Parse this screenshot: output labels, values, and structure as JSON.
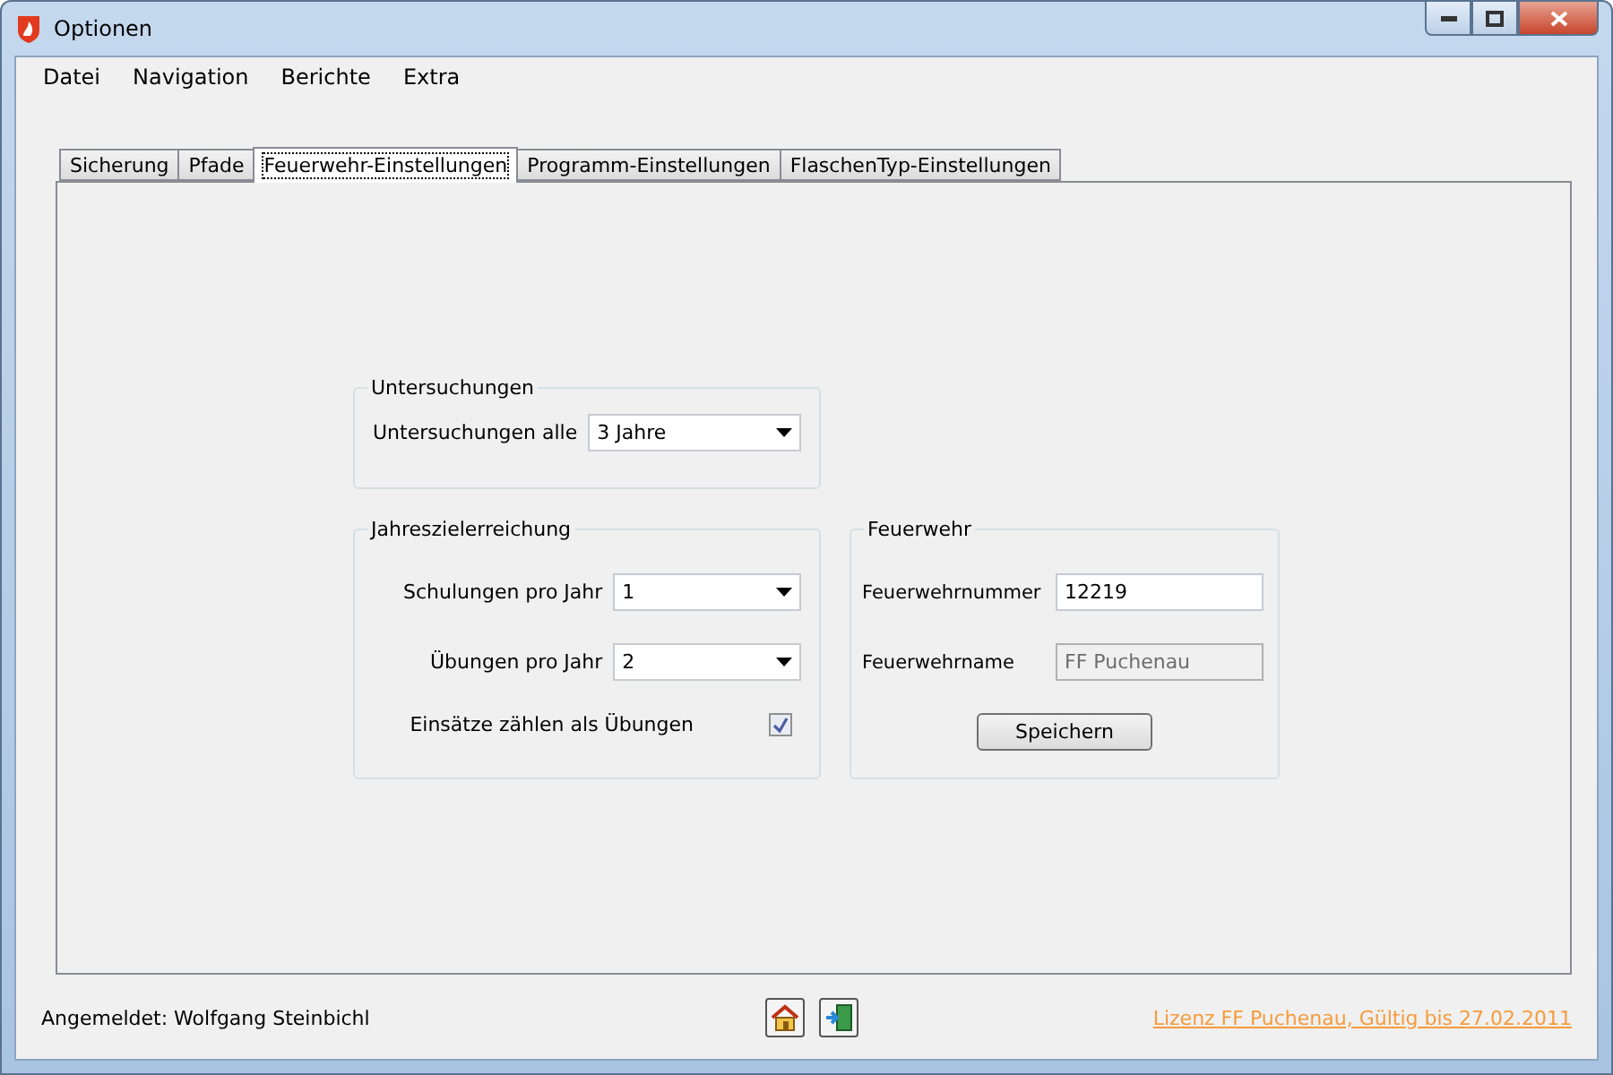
{
  "window": {
    "title": "Optionen"
  },
  "menu": [
    "Datei",
    "Navigation",
    "Berichte",
    "Extra"
  ],
  "tabs": [
    {
      "label": "Sicherung",
      "selected": false
    },
    {
      "label": "Pfade",
      "selected": false
    },
    {
      "label": "Feuerwehr-Einstellungen",
      "selected": true
    },
    {
      "label": "Programm-Einstellungen",
      "selected": false
    },
    {
      "label": "FlaschenTyp-Einstellungen",
      "selected": false
    }
  ],
  "untersuchungen": {
    "title": "Untersuchungen",
    "label": "Untersuchungen alle",
    "value": "3 Jahre"
  },
  "jahreszielerreichung": {
    "title": "Jahreszielerreichung",
    "fields": [
      {
        "label": "Schulungen pro Jahr",
        "value": "1"
      },
      {
        "label": "Übungen pro Jahr",
        "value": "2"
      }
    ],
    "checkbox": {
      "label": "Einsätze zählen als Übungen",
      "checked": true
    }
  },
  "feuerwehr": {
    "title": "Feuerwehr",
    "fields": [
      {
        "label": "Feuerwehrnummer",
        "value": "12219",
        "disabled": false
      },
      {
        "label": "Feuerwehrname",
        "value": "FF Puchenau",
        "disabled": true
      }
    ],
    "button": "Speichern"
  },
  "status_bar": {
    "user": "Angemeldet: Wolfgang Steinbichl",
    "license": "Lizenz FF Puchenau, Gültig bis 27.02.2011"
  }
}
